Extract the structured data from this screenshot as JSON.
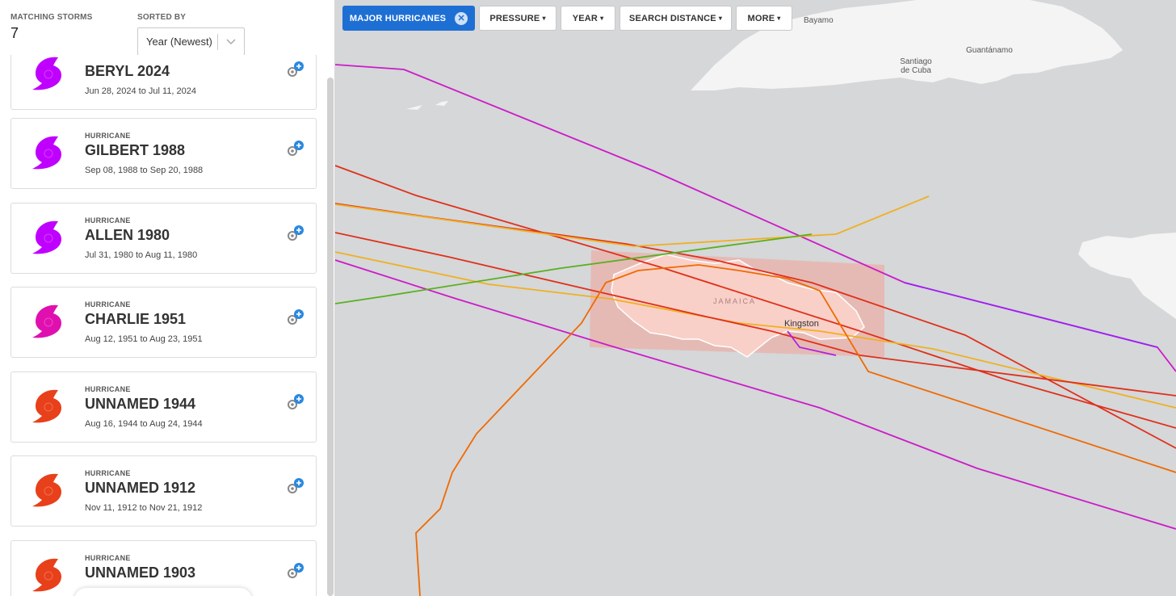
{
  "sidebar": {
    "count_label": "MATCHING STORMS",
    "count": "7",
    "sort_label": "SORTED BY",
    "sort_value": "Year (Newest)"
  },
  "storms": [
    {
      "type": "",
      "name": "BERYL 2024",
      "dates": "Jun 28, 2024 to Jul 11, 2024",
      "color": "#c000ff"
    },
    {
      "type": "HURRICANE",
      "name": "GILBERT 1988",
      "dates": "Sep 08, 1988 to Sep 20, 1988",
      "color": "#c000ff"
    },
    {
      "type": "HURRICANE",
      "name": "ALLEN 1980",
      "dates": "Jul 31, 1980 to Aug 11, 1980",
      "color": "#c000ff"
    },
    {
      "type": "HURRICANE",
      "name": "CHARLIE 1951",
      "dates": "Aug 12, 1951 to Aug 23, 1951",
      "color": "#e010b0"
    },
    {
      "type": "HURRICANE",
      "name": "UNNAMED 1944",
      "dates": "Aug 16, 1944 to Aug 24, 1944",
      "color": "#e8401a"
    },
    {
      "type": "HURRICANE",
      "name": "UNNAMED 1912",
      "dates": "Nov 11, 1912 to Nov 21, 1912",
      "color": "#e8401a"
    },
    {
      "type": "HURRICANE",
      "name": "UNNAMED 1903",
      "dates": "",
      "color": "#e8401a"
    }
  ],
  "filters": {
    "major_hurricanes": "MAJOR HURRICANES",
    "pressure": "PRESSURE",
    "year": "YEAR",
    "search_distance": "SEARCH DISTANCE",
    "more": "MORE"
  },
  "map": {
    "places": {
      "bayamo": "Bayamo",
      "santiago": "Santiago\nde Cuba",
      "guantanamo": "Guantánamo",
      "jamaica": "JAMAICA",
      "kingston": "Kingston"
    }
  },
  "colors": {
    "accent": "#1e6fd4",
    "land": "#f4f4f4",
    "water": "#d5d7d9",
    "search_box": "#f2a398"
  }
}
